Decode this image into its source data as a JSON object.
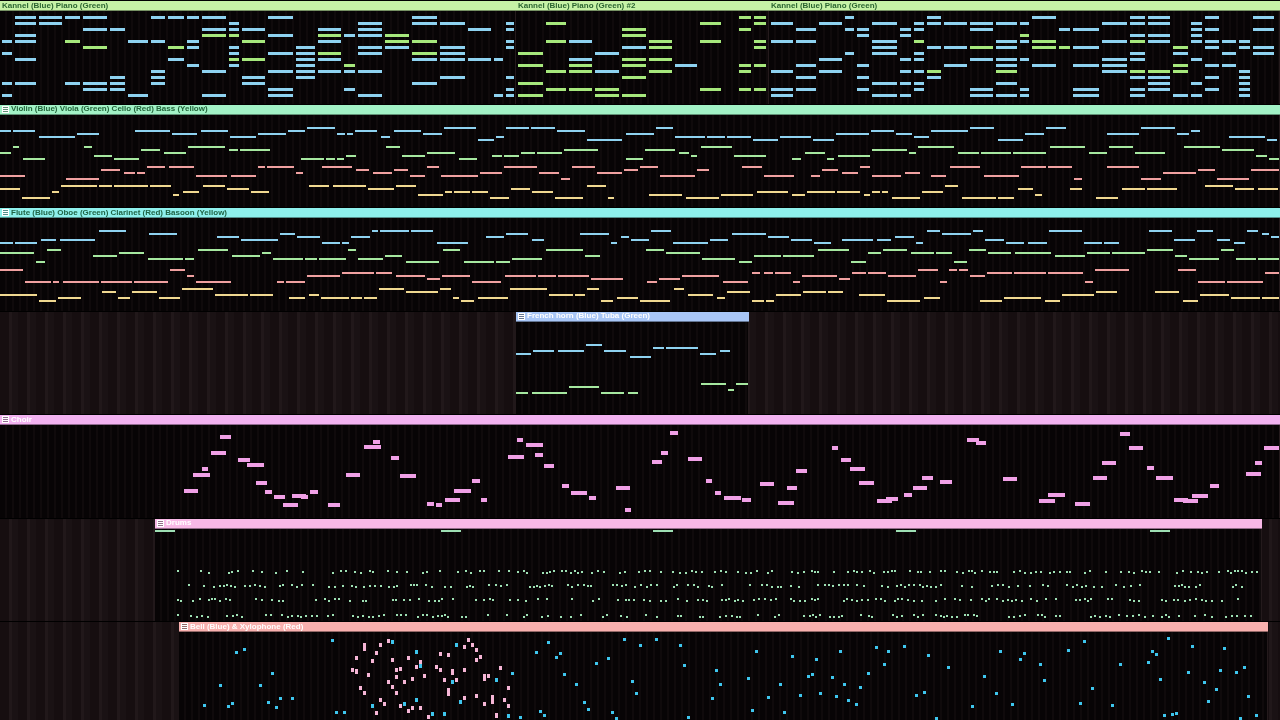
{
  "tracks": [
    {
      "clips": [
        {
          "label": "Kannel (Blue) Piano (Green)",
          "color": "#c6f2a6",
          "icon": false,
          "kind": "chords",
          "voices": [
            {
              "color": "#8ed2f0"
            },
            {
              "color": "#a6e87c"
            }
          ]
        },
        {
          "label": "Kannel (Blue) Piano (Green) #2",
          "color": "#c6f2a6",
          "icon": false,
          "kind": "chords",
          "voices": [
            {
              "color": "#a6e87c"
            },
            {
              "color": "#8ed2f0"
            }
          ]
        },
        {
          "label": "Kannel (Blue) Piano (Green)",
          "color": "#c6f2a6",
          "icon": false,
          "kind": "chords",
          "voices": [
            {
              "color": "#8ed2f0"
            },
            {
              "color": "#a6e87c"
            }
          ]
        }
      ]
    },
    {
      "clips": [
        {
          "label": "Violin (Blue) Viola (Green) Cello (Red) Bass (Yellow)",
          "color": "#a2f2c6",
          "icon": true,
          "kind": "lines",
          "voices": [
            {
              "color": "#8ed2f0"
            },
            {
              "color": "#a6e8a0"
            },
            {
              "color": "#f0a0a0"
            },
            {
              "color": "#f0d890"
            }
          ]
        }
      ]
    },
    {
      "clips": [
        {
          "label": "Flute (Blue) Oboe (Green) Clarinet (Red) Basoon (Yellow)",
          "color": "#8ef0ec",
          "icon": true,
          "kind": "lines",
          "voices": [
            {
              "color": "#8ed2f0"
            },
            {
              "color": "#a6e8a0"
            },
            {
              "color": "#f0a0a0"
            },
            {
              "color": "#f0d890"
            }
          ]
        }
      ]
    },
    {
      "clips": [
        {
          "label": "French horn (Blue) Tuba (Green)",
          "color": "#a8c6f6",
          "icon": true,
          "kind": "lines",
          "voices": [
            {
              "color": "#8ed2f0"
            },
            {
              "color": "#a6e8a0"
            }
          ]
        }
      ]
    },
    {
      "clips": [
        {
          "label": "Choir",
          "color": "#f2b2f0",
          "icon": true,
          "kind": "choir",
          "voices": [
            {
              "color": "#f0a0e6"
            }
          ]
        }
      ]
    },
    {
      "clips": [
        {
          "label": "Drums",
          "color": "#f8b8e6",
          "icon": true,
          "kind": "drums",
          "voices": [
            {
              "color": "#9ee0b4"
            }
          ]
        }
      ]
    },
    {
      "clips": [
        {
          "label": "Bell (Blue) & Xylophone (Red)",
          "color": "#f8b0ae",
          "icon": true,
          "kind": "sparse",
          "voices": [
            {
              "color": "#3ec6ee"
            },
            {
              "color": "#f6b6d6"
            }
          ]
        }
      ]
    }
  ]
}
